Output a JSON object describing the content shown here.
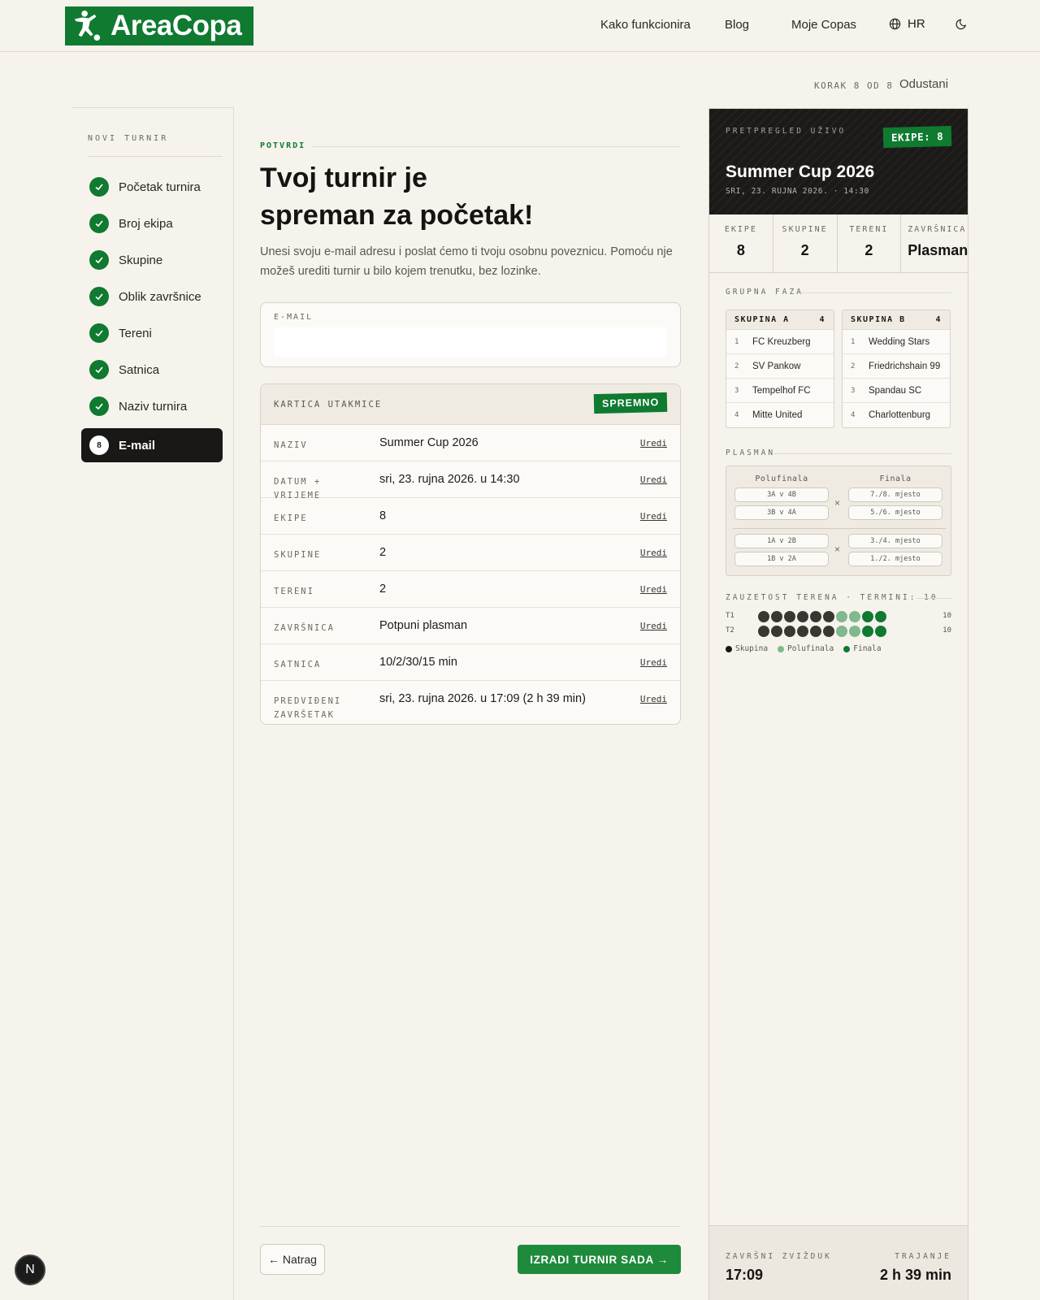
{
  "brand": {
    "name": "AreaCopa",
    "color": "#0f7a30"
  },
  "nav": {
    "how": "Kako funkcionira",
    "blog": "Blog",
    "mine": "Moje Copas",
    "lang": "HR"
  },
  "wizard": {
    "step": "KORAK 8 OD 8",
    "cancel": "Odustani"
  },
  "sidebar": {
    "title": "NOVI TURNIR",
    "steps": [
      {
        "label": "Početak turnira"
      },
      {
        "label": "Broj ekipa"
      },
      {
        "label": "Skupine"
      },
      {
        "label": "Oblik završnice"
      },
      {
        "label": "Tereni"
      },
      {
        "label": "Satnica"
      },
      {
        "label": "Naziv turnira"
      },
      {
        "label": "E-mail",
        "num": "8"
      }
    ]
  },
  "main": {
    "eyebrow": "POTVRDI",
    "title_line1": "Tvoj turnir je",
    "title_line2": "spreman za početak!",
    "lead": "Unesi svoju e-mail adresu i poslat ćemo ti tvoju osobnu poveznicu. Pomoću nje možeš urediti turnir u bilo kojem trenutku, bez lozinke.",
    "email_label": "E-MAIL",
    "email_value": "",
    "card": {
      "title": "KARTICA UTAKMICE",
      "badge": "SPREMNO",
      "edit": "Uredi",
      "rows": [
        {
          "k": "NAZIV",
          "v": "Summer Cup 2026"
        },
        {
          "k": "DATUM + VRIJEME",
          "v": "sri, 23. rujna 2026. u 14:30"
        },
        {
          "k": "EKIPE",
          "v": "8"
        },
        {
          "k": "SKUPINE",
          "v": "2"
        },
        {
          "k": "TERENI",
          "v": "2"
        },
        {
          "k": "ZAVRŠNICA",
          "v": "Potpuni plasman"
        },
        {
          "k": "SATNICA",
          "v": "10/2/30/15 min"
        },
        {
          "k": "PREDVIĐENI ZAVRŠETAK",
          "v": "sri, 23. rujna 2026. u 17:09 (2 h 39 min)"
        }
      ]
    },
    "back": "← Natrag",
    "create": "IZRADI TURNIR SADA →"
  },
  "preview": {
    "live": "PRETPREGLED UŽIVO",
    "teams_badge": "EKIPE: 8",
    "title": "Summer Cup 2026",
    "date": "SRI, 23. RUJNA 2026. · 14:30",
    "stats": [
      {
        "k": "EKIPE",
        "v": "8"
      },
      {
        "k": "SKUPINE",
        "v": "2"
      },
      {
        "k": "TERENI",
        "v": "2"
      },
      {
        "k": "ZAVRŠNICA",
        "v": "Plasman"
      }
    ],
    "group_title": "GRUPNA FAZA",
    "groups": [
      {
        "name": "SKUPINA A",
        "count": "4",
        "teams": [
          "FC Kreuzberg",
          "SV Pankow",
          "Tempelhof FC",
          "Mitte United"
        ]
      },
      {
        "name": "SKUPINA B",
        "count": "4",
        "teams": [
          "Wedding Stars",
          "Friedrichshain 99",
          "Spandau SC",
          "Charlottenburg"
        ]
      }
    ],
    "placement_title": "PLASMAN",
    "bracket": {
      "semis_label": "Polufinala",
      "finals_label": "Finala",
      "x": "×",
      "top": {
        "semis": [
          "3A v 4B",
          "3B v 4A"
        ],
        "finals": [
          "7./8. mjesto",
          "5./6. mjesto"
        ]
      },
      "bottom": {
        "semis": [
          "1A v 2B",
          "1B v 2A"
        ],
        "finals": [
          "3./4. mjesto",
          "1./2. mjesto"
        ]
      }
    },
    "courts_title": "ZAUZETOST TERENA · TERMINI: 10",
    "courts": [
      {
        "name": "T1",
        "slots": [
          "group",
          "group",
          "group",
          "group",
          "group",
          "group",
          "semi",
          "semi",
          "final",
          "final"
        ],
        "count": "10"
      },
      {
        "name": "T2",
        "slots": [
          "group",
          "group",
          "group",
          "group",
          "group",
          "group",
          "semi",
          "semi",
          "final",
          "final"
        ],
        "count": "10"
      }
    ],
    "slot_colors": {
      "group": "#3a3632",
      "semi": "#7fb98d",
      "final": "#0f7a30"
    },
    "legend": {
      "group": "Skupina",
      "semi": "Polufinala",
      "final": "Finala"
    },
    "foot": {
      "k1": "ZAVRŠNI ZVIŽDUK",
      "v1": "17:09",
      "k2": "TRAJANJE",
      "v2": "2 h 39 min"
    }
  },
  "dev_badge": "N"
}
